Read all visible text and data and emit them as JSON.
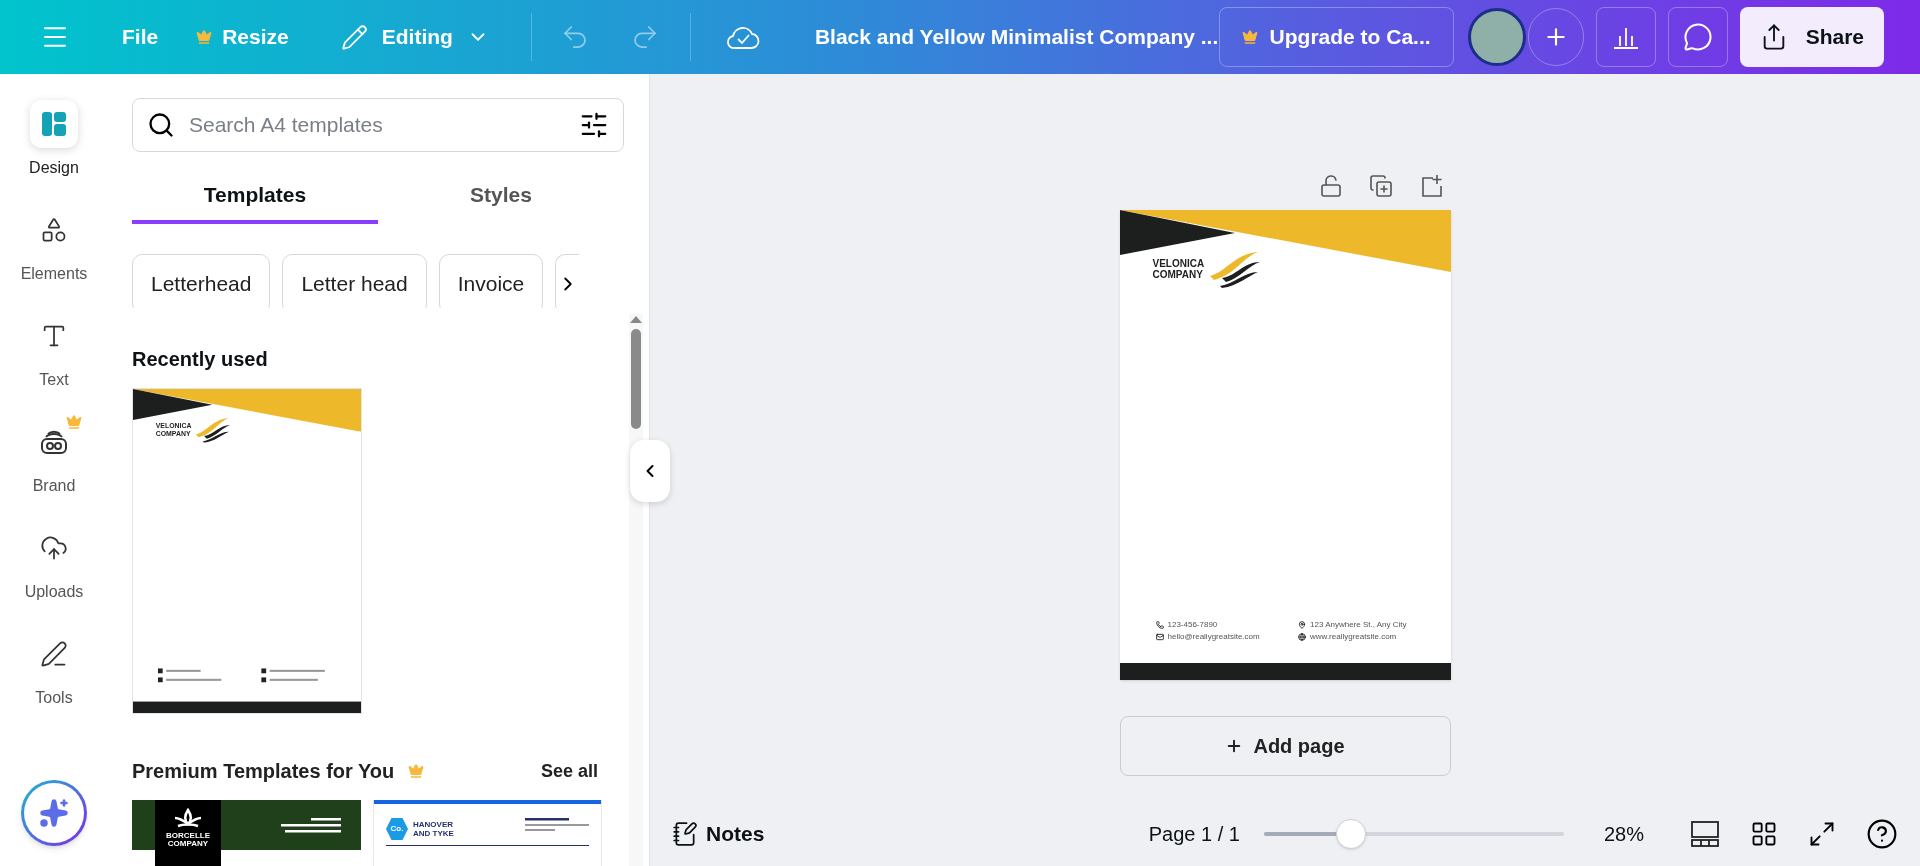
{
  "topbar": {
    "file": "File",
    "resize": "Resize",
    "mode": "Editing",
    "title": "Black and Yellow Minimalist Company ...",
    "upgrade": "Upgrade to Ca...",
    "share": "Share"
  },
  "rail": [
    {
      "kind": "design",
      "label": "Design",
      "selected": true,
      "premium": false
    },
    {
      "kind": "elements",
      "label": "Elements",
      "selected": false,
      "premium": false
    },
    {
      "kind": "text",
      "label": "Text",
      "selected": false,
      "premium": false
    },
    {
      "kind": "brand",
      "label": "Brand",
      "selected": false,
      "premium": true
    },
    {
      "kind": "uploads",
      "label": "Uploads",
      "selected": false,
      "premium": false
    },
    {
      "kind": "tools",
      "label": "Tools",
      "selected": false,
      "premium": false
    }
  ],
  "panel": {
    "search": {
      "placeholder": "Search A4 templates"
    },
    "tabs": [
      {
        "label": "Templates",
        "selected": true
      },
      {
        "label": "Styles",
        "selected": false
      }
    ],
    "chips": [
      "Letterhead",
      "Letter head",
      "Invoice"
    ],
    "recent_title": "Recently used",
    "recent": [
      {
        "name_lines": [
          "VELONICA",
          "COMPANY"
        ]
      }
    ],
    "premium_title": "Premium Templates for You",
    "see_all": "See all",
    "premium": [
      {
        "kind": "green",
        "name_lines": [
          "BORCELLE",
          "COMPANY"
        ]
      },
      {
        "kind": "blue",
        "badge": "Co.",
        "name_lines": [
          "HANOVER",
          "AND TYKE"
        ]
      }
    ]
  },
  "page": {
    "name_lines": [
      "VELONICA",
      "COMPANY"
    ],
    "contacts": [
      {
        "kind": "phone",
        "text": "123-456-7890"
      },
      {
        "kind": "email",
        "text": "hello@reallygreatsite.com"
      },
      {
        "kind": "location",
        "text": "123 Anywhere St., Any City"
      },
      {
        "kind": "web",
        "text": "www.reallygreatsite.com"
      }
    ]
  },
  "add_page": "Add page",
  "footer": {
    "notes": "Notes",
    "page_label": "Page 1 / 1",
    "zoom": {
      "level": 0.29
    },
    "zoom_reading": "28%"
  }
}
